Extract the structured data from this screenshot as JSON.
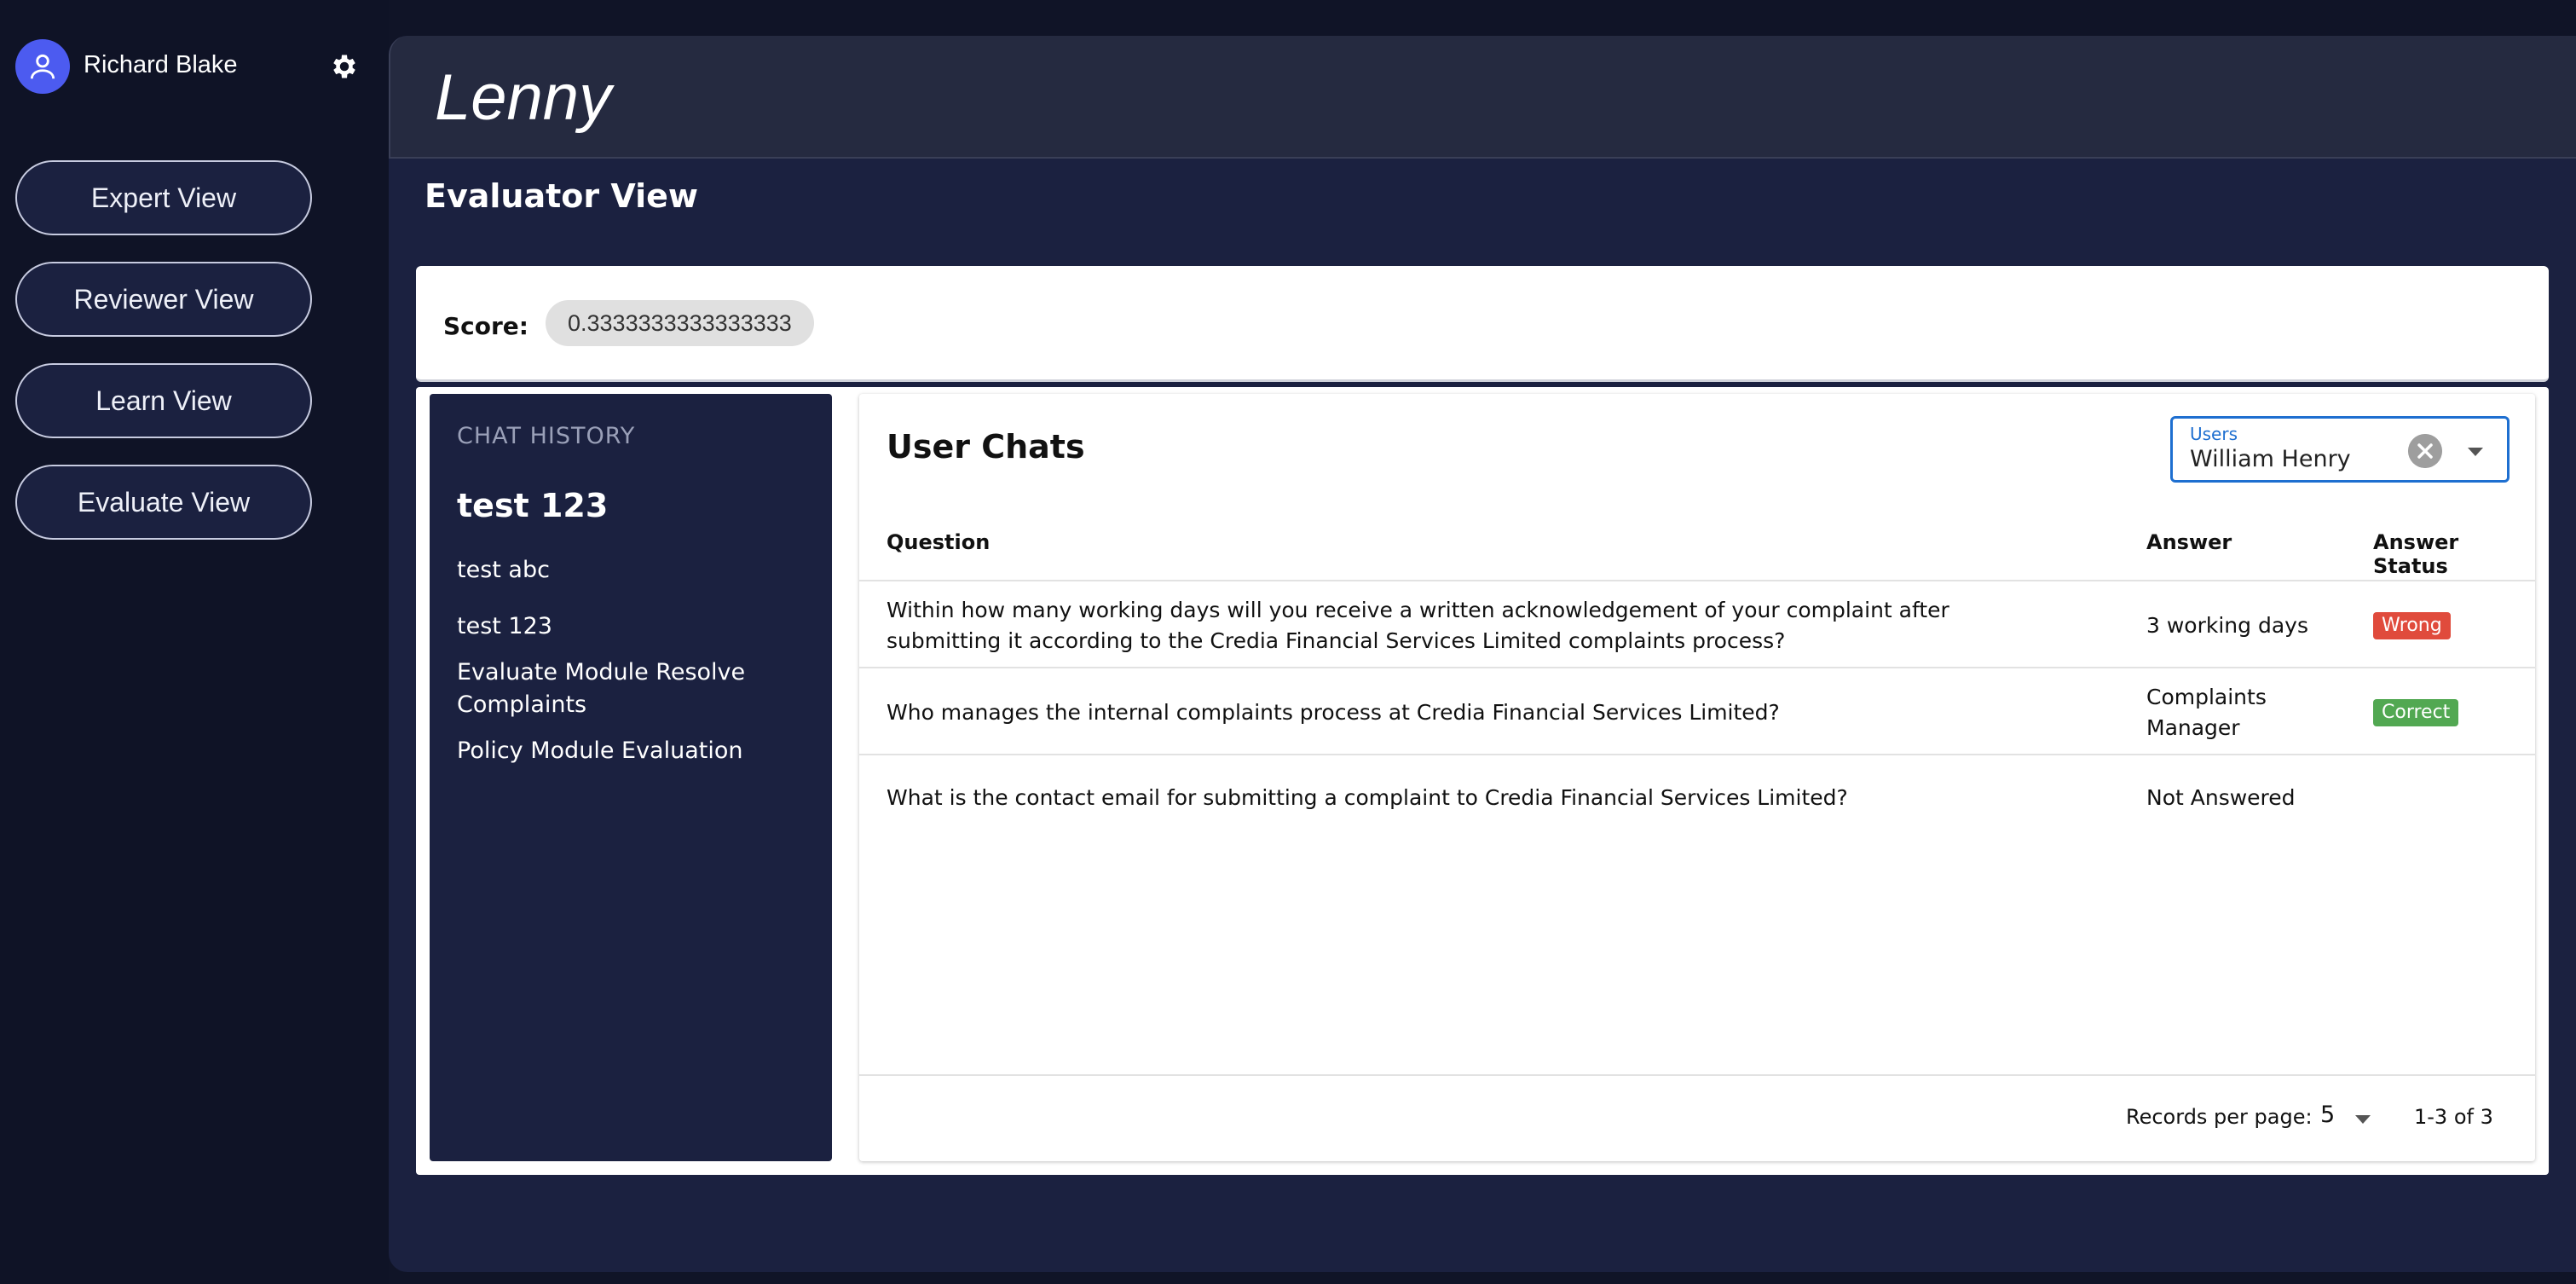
{
  "user": {
    "name": "Richard Blake"
  },
  "nav": {
    "items": [
      {
        "label": "Expert View"
      },
      {
        "label": "Reviewer View"
      },
      {
        "label": "Learn View"
      },
      {
        "label": "Evaluate View"
      }
    ]
  },
  "brand": {
    "logo_text": "Lenny"
  },
  "page": {
    "title": "Evaluator View"
  },
  "score": {
    "label": "Score:",
    "value": "0.3333333333333333"
  },
  "history": {
    "title": "CHAT HISTORY",
    "items": [
      {
        "label": "test 123",
        "active": true
      },
      {
        "label": "test abc"
      },
      {
        "label": "test 123"
      },
      {
        "label": "Evaluate Module Resolve Complaints"
      },
      {
        "label": "Policy Module Evaluation"
      }
    ]
  },
  "chats": {
    "title": "User Chats",
    "user_select": {
      "label": "Users",
      "value": "William Henry"
    },
    "columns": {
      "question": "Question",
      "answer": "Answer",
      "status": "Answer Status"
    },
    "rows": [
      {
        "question": "Within how many working days will you receive a written acknowledgement of your complaint after submitting it according to the Credia Financial Services Limited complaints process?",
        "answer": "3 working days",
        "status": "Wrong"
      },
      {
        "question": "Who manages the internal complaints process at Credia Financial Services Limited?",
        "answer": "Complaints Manager",
        "status": "Correct"
      },
      {
        "question": "What is the contact email for submitting a complaint to Credia Financial Services Limited?",
        "answer": "Not Answered",
        "status": ""
      }
    ],
    "pagination": {
      "records_label": "Records per page:",
      "records_value": "5",
      "range": "1-3 of 3"
    }
  },
  "colors": {
    "background": "#0f1326",
    "panel": "#1b2140",
    "accent": "#1e6fd0",
    "wrong": "#e04b3c",
    "correct": "#52a852",
    "avatar": "#4c5bf0"
  }
}
